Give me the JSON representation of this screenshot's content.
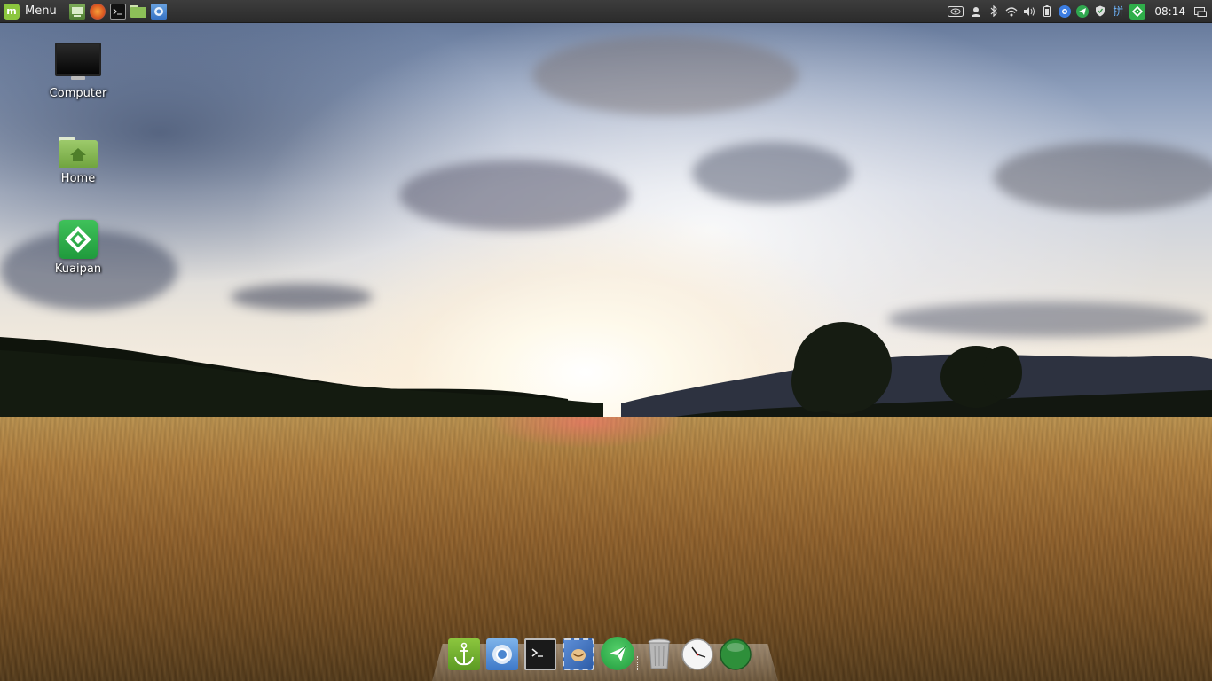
{
  "panel": {
    "menu_label": "Menu",
    "launchers": [
      "show-desktop",
      "firefox",
      "terminal",
      "files",
      "chromium"
    ],
    "tray_icons": [
      "eye-icon",
      "user-icon",
      "bluetooth-icon",
      "wifi-icon",
      "volume-icon",
      "battery-icon",
      "chrome-icon",
      "telegram-icon",
      "shield-icon",
      "keyboard-layout-icon",
      "kuaipan-icon",
      "window-list-icon"
    ],
    "keyboard_layout_label": "拼",
    "clock": "08:14"
  },
  "desktop": {
    "icons": [
      {
        "label": "Computer",
        "icon": "computer-icon"
      },
      {
        "label": "Home",
        "icon": "home-folder-icon"
      },
      {
        "label": "Kuaipan",
        "icon": "kuaipan-icon"
      }
    ]
  },
  "dock": {
    "items": [
      "anchor-app-icon",
      "chromium-icon",
      "terminal-icon",
      "mail-icon",
      "telegram-icon",
      "trash-icon",
      "clock-app-icon",
      "green-orb-icon"
    ]
  },
  "colors": {
    "panel_bg": "#2b2b2b",
    "mint_green": "#8cc63e",
    "kuaipan_green": "#2fae4a"
  }
}
